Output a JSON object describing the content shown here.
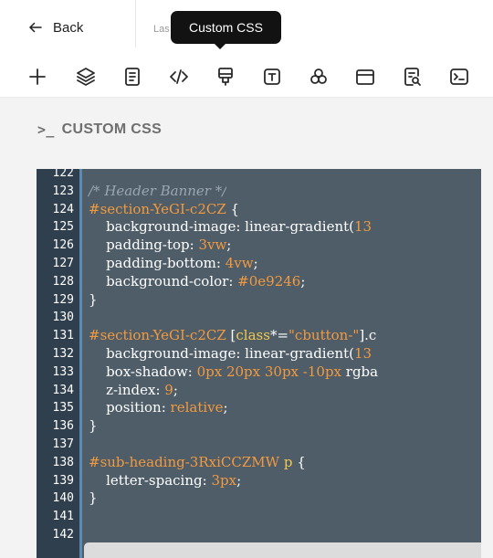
{
  "header": {
    "back_label": "Back",
    "last_text": "Las",
    "tooltip": "Custom CSS"
  },
  "toolbar": {
    "tools": [
      {
        "icon": "plus-icon"
      },
      {
        "icon": "layers-icon"
      },
      {
        "icon": "document-icon"
      },
      {
        "icon": "code-icon"
      },
      {
        "icon": "custom-css-icon"
      },
      {
        "icon": "text-icon"
      },
      {
        "icon": "shapes-icon"
      },
      {
        "icon": "window-icon"
      },
      {
        "icon": "page-search-icon"
      },
      {
        "icon": "terminal-icon"
      }
    ]
  },
  "panel": {
    "icon": ">_",
    "title": "CUSTOM CSS"
  },
  "editor": {
    "lines": [
      {
        "n": "122",
        "segments": []
      },
      {
        "n": "123",
        "segments": [
          {
            "t": "/* Header Banner */",
            "c": "c-comment"
          }
        ]
      },
      {
        "n": "124",
        "segments": [
          {
            "t": "#section-YeGI-c2CZ",
            "c": "c-sel"
          },
          {
            "t": " {",
            "c": "c-plain"
          }
        ]
      },
      {
        "n": "125",
        "segments": [
          {
            "t": "    background-image: linear-gradient(",
            "c": "c-prop"
          },
          {
            "t": "13",
            "c": "c-num"
          }
        ]
      },
      {
        "n": "126",
        "segments": [
          {
            "t": "    padding-top: ",
            "c": "c-prop"
          },
          {
            "t": "3vw",
            "c": "c-num"
          },
          {
            "t": ";",
            "c": "c-plain"
          }
        ]
      },
      {
        "n": "127",
        "segments": [
          {
            "t": "    padding-bottom: ",
            "c": "c-prop"
          },
          {
            "t": "4vw",
            "c": "c-num"
          },
          {
            "t": ";",
            "c": "c-plain"
          }
        ]
      },
      {
        "n": "128",
        "segments": [
          {
            "t": "    background-color: ",
            "c": "c-prop"
          },
          {
            "t": "#0e9246",
            "c": "c-num"
          },
          {
            "t": ";",
            "c": "c-plain"
          }
        ]
      },
      {
        "n": "129",
        "segments": [
          {
            "t": "}",
            "c": "c-plain"
          }
        ]
      },
      {
        "n": "130",
        "segments": []
      },
      {
        "n": "131",
        "segments": [
          {
            "t": "#section-YeGI-c2CZ",
            "c": "c-sel"
          },
          {
            "t": " [",
            "c": "c-plain"
          },
          {
            "t": "class",
            "c": "c-attr"
          },
          {
            "t": "*=",
            "c": "c-plain"
          },
          {
            "t": "\"cbutton-\"",
            "c": "c-str"
          },
          {
            "t": "].c",
            "c": "c-plain"
          }
        ]
      },
      {
        "n": "132",
        "segments": [
          {
            "t": "    background-image: linear-gradient(",
            "c": "c-prop"
          },
          {
            "t": "13",
            "c": "c-num"
          }
        ]
      },
      {
        "n": "133",
        "segments": [
          {
            "t": "    box-shadow: ",
            "c": "c-prop"
          },
          {
            "t": "0px 20px 30px -10px",
            "c": "c-num"
          },
          {
            "t": " rgba",
            "c": "c-prop"
          }
        ]
      },
      {
        "n": "134",
        "segments": [
          {
            "t": "    z-index: ",
            "c": "c-prop"
          },
          {
            "t": "9",
            "c": "c-num"
          },
          {
            "t": ";",
            "c": "c-plain"
          }
        ]
      },
      {
        "n": "135",
        "segments": [
          {
            "t": "    position: ",
            "c": "c-prop"
          },
          {
            "t": "relative",
            "c": "c-num"
          },
          {
            "t": ";",
            "c": "c-plain"
          }
        ]
      },
      {
        "n": "136",
        "segments": [
          {
            "t": "}",
            "c": "c-plain"
          }
        ]
      },
      {
        "n": "137",
        "segments": []
      },
      {
        "n": "138",
        "segments": [
          {
            "t": "#sub-heading-3RxiCCZMW",
            "c": "c-sel"
          },
          {
            "t": " ",
            "c": "c-plain"
          },
          {
            "t": "p",
            "c": "c-tag"
          },
          {
            "t": " {",
            "c": "c-plain"
          }
        ]
      },
      {
        "n": "139",
        "segments": [
          {
            "t": "    letter-spacing: ",
            "c": "c-prop"
          },
          {
            "t": "3px",
            "c": "c-num"
          },
          {
            "t": ";",
            "c": "c-plain"
          }
        ]
      },
      {
        "n": "140",
        "segments": [
          {
            "t": "}",
            "c": "c-plain"
          }
        ]
      },
      {
        "n": "141",
        "segments": []
      },
      {
        "n": "142",
        "segments": []
      }
    ]
  },
  "colors": {
    "editor_bg": "#4f5d69",
    "gutter_bg": "#2f3f4d",
    "gutter_accent": "#5c8ab2",
    "selector_orange": "#f29a3f",
    "tooltip_bg": "#121212"
  }
}
